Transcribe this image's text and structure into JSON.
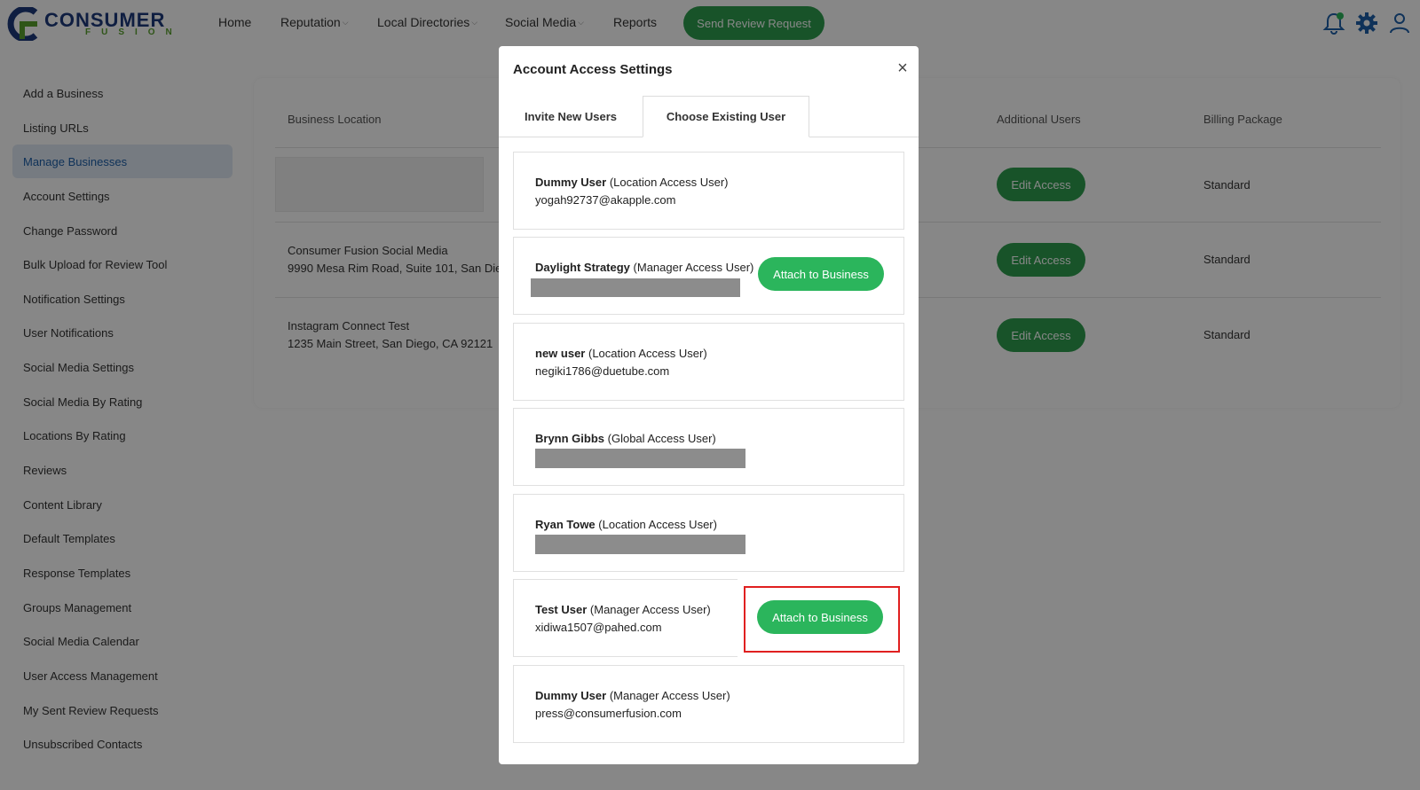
{
  "brand": {
    "name": "CONSUMER",
    "sub": "FUSION",
    "colors": {
      "navy": "#1d3a7c",
      "green": "#5aa12f",
      "button": "#2e9e4f"
    }
  },
  "nav": {
    "items": [
      {
        "label": "Home"
      },
      {
        "label": "Reputation"
      },
      {
        "label": "Local Directories"
      },
      {
        "label": "Social Media"
      },
      {
        "label": "Reports"
      }
    ],
    "send_review_label": "Send Review Request",
    "icons": [
      "bell-icon",
      "gear-icon",
      "user-icon"
    ]
  },
  "sidebar": {
    "items": [
      {
        "label": "Add a Business"
      },
      {
        "label": "Listing URLs"
      },
      {
        "label": "Manage Businesses"
      },
      {
        "label": "Account Settings"
      },
      {
        "label": "Change Password"
      },
      {
        "label": "Bulk Upload for Review Tool"
      },
      {
        "label": "Notification Settings"
      },
      {
        "label": "User Notifications"
      },
      {
        "label": "Social Media Settings"
      },
      {
        "label": "Social Media By Rating"
      },
      {
        "label": "Locations By Rating"
      },
      {
        "label": "Reviews"
      },
      {
        "label": "Content Library"
      },
      {
        "label": "Default Templates"
      },
      {
        "label": "Response Templates"
      },
      {
        "label": "Groups Management"
      },
      {
        "label": "Social Media Calendar"
      },
      {
        "label": "User Access Management"
      },
      {
        "label": "My Sent Review Requests"
      },
      {
        "label": "Unsubscribed Contacts"
      }
    ],
    "active_index": 2
  },
  "table": {
    "headers": {
      "location": "Business Location",
      "additional": "Additional Users",
      "billing": "Billing Package"
    },
    "rows": [
      {
        "name": "",
        "address": "",
        "action": "Edit Access",
        "billing": "Standard"
      },
      {
        "name": "Consumer Fusion Social Media",
        "address": "9990 Mesa Rim Road, Suite 101, San Die",
        "action": "Edit Access",
        "billing": "Standard"
      },
      {
        "name": "Instagram Connect Test",
        "address": "1235 Main Street, San Diego, CA 92121",
        "action": "Edit Access",
        "billing": "Standard"
      }
    ]
  },
  "modal": {
    "title": "Account Access Settings",
    "close": "×",
    "tabs": [
      {
        "label": "Invite New Users"
      },
      {
        "label": "Choose Existing User"
      }
    ],
    "users": [
      {
        "name": "Dummy User",
        "role": "(Location Access User)",
        "email": "yogah92737@akapple.com"
      },
      {
        "name": "Daylight Strategy",
        "role": "(Manager Access User)",
        "email": "",
        "action": "Attach to Business"
      },
      {
        "name": "new user",
        "role": "(Location Access User)",
        "email": "negiki1786@duetube.com"
      },
      {
        "name": "Brynn Gibbs",
        "role": "(Global Access User)",
        "email": ""
      },
      {
        "name": "Ryan Towe",
        "role": "(Location Access User)",
        "email": ""
      },
      {
        "name": "Test User",
        "role": "(Manager Access User)",
        "email": "xidiwa1507@pahed.com",
        "action": "Attach to Business"
      },
      {
        "name": "Dummy User",
        "role": "(Manager Access User)",
        "email": "press@consumerfusion.com"
      }
    ]
  }
}
